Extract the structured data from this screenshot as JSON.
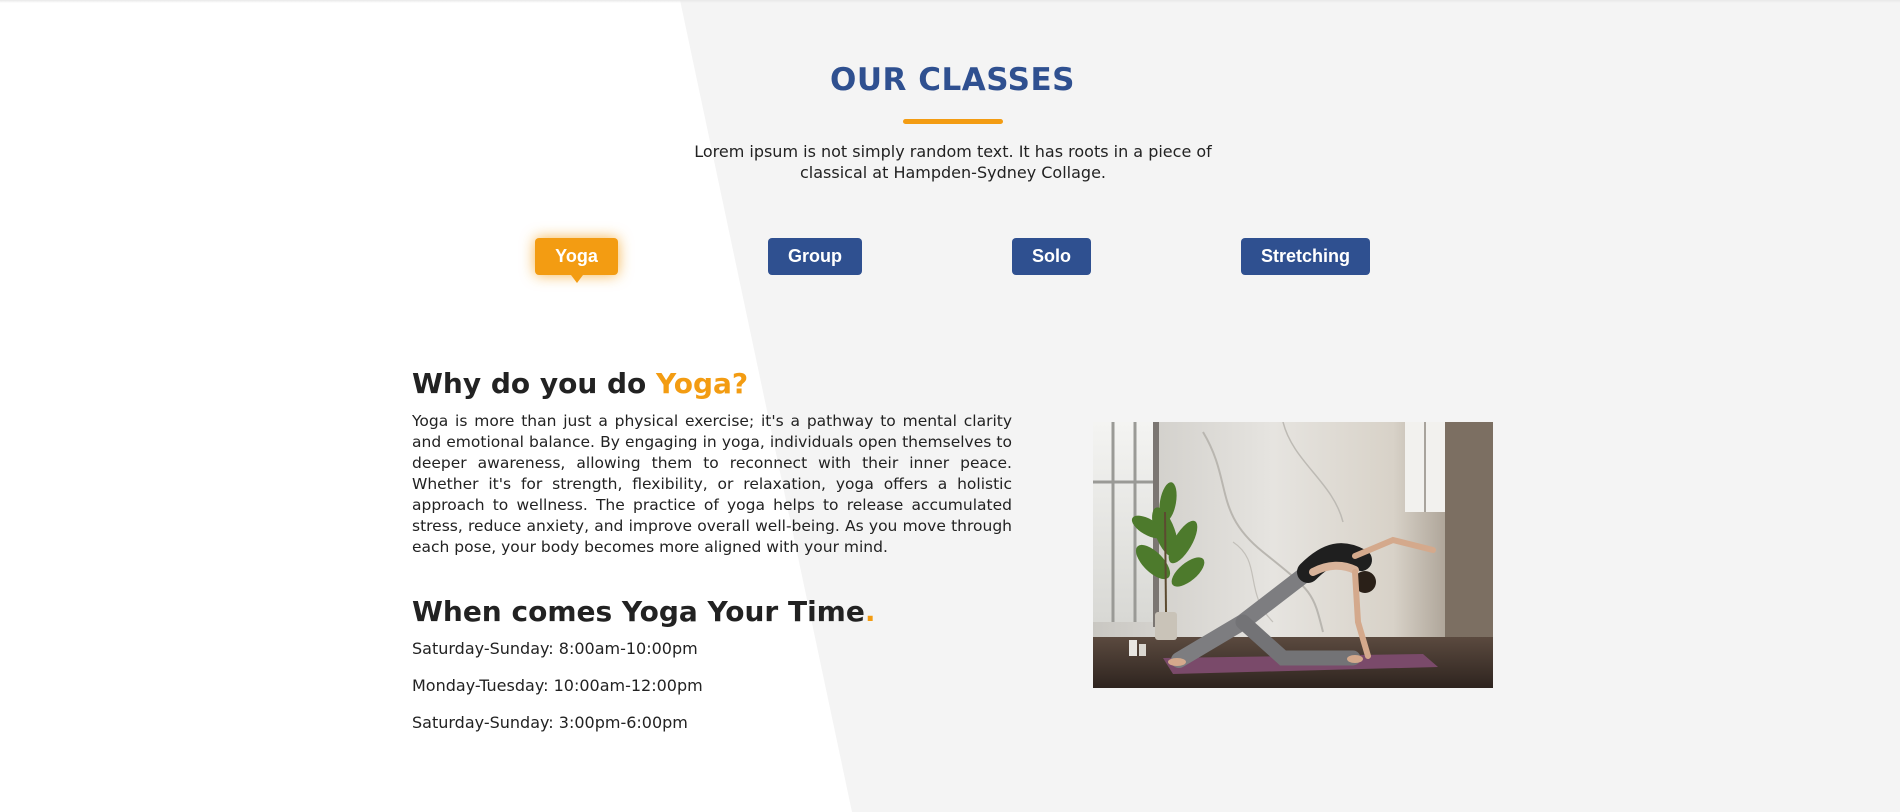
{
  "section": {
    "title": "OUR CLASSES",
    "description": "Lorem ipsum is not simply random text. It has roots in a piece of classical at Hampden-Sydney Collage."
  },
  "tabs": [
    {
      "label": "Yoga",
      "active": true
    },
    {
      "label": "Group",
      "active": false
    },
    {
      "label": "Solo",
      "active": false
    },
    {
      "label": "Stretching",
      "active": false
    }
  ],
  "content": {
    "why_prefix": "Why do you do ",
    "why_highlight": "Yoga?",
    "paragraph": "Yoga is more than just a physical exercise; it's a pathway to mental clarity and emotional balance. By engaging in yoga, individuals open themselves to deeper awareness, allowing them to reconnect with their inner peace. Whether it's for strength, flexibility, or relaxation, yoga offers a holistic approach to wellness. The practice of yoga helps to release accumulated stress, reduce anxiety, and improve overall well-being. As you move through each pose, your body becomes more aligned with your mind.",
    "when_title": "When comes Yoga Your Time",
    "when_dot": ".",
    "schedule": [
      "Saturday-Sunday: 8:00am-10:00pm",
      "Monday-Tuesday: 10:00am-12:00pm",
      "Saturday-Sunday: 3:00pm-6:00pm"
    ],
    "image_subject": "woman-doing-yoga-photo"
  },
  "colors": {
    "primary": "#2f5090",
    "accent": "#f39c12",
    "background": "#f4f4f4",
    "text": "#222222"
  }
}
